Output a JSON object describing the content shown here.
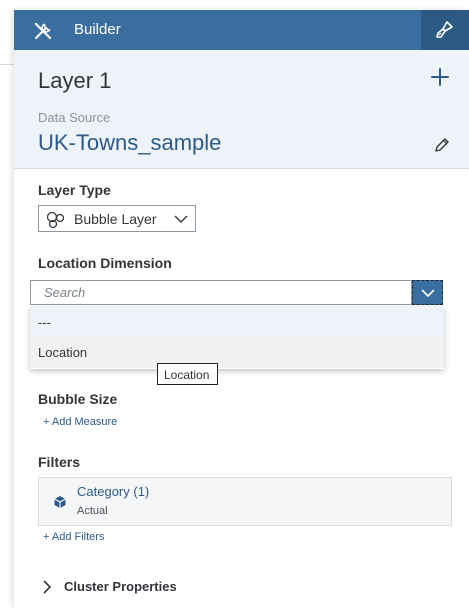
{
  "header": {
    "title": "Builder"
  },
  "layer": {
    "title": "Layer 1",
    "data_source_label": "Data Source",
    "data_source_value": "UK-Towns_sample"
  },
  "layer_type": {
    "label": "Layer Type",
    "selected": "Bubble Layer"
  },
  "location_dimension": {
    "label": "Location Dimension",
    "search_placeholder": "Search",
    "options": [
      "---",
      "Location"
    ],
    "tooltip": "Location"
  },
  "bubble_size": {
    "label": "Bubble Size",
    "add_link": "+ Add Measure"
  },
  "filters": {
    "label": "Filters",
    "items": [
      {
        "title": "Category (1)",
        "subtitle": "Actual"
      }
    ],
    "add_link": "+ Add Filters"
  },
  "cluster": {
    "label": "Cluster Properties"
  },
  "colors": {
    "header": "#3a6e9e",
    "accent": "#2c5b8a",
    "section_bg": "#edf3f8"
  }
}
